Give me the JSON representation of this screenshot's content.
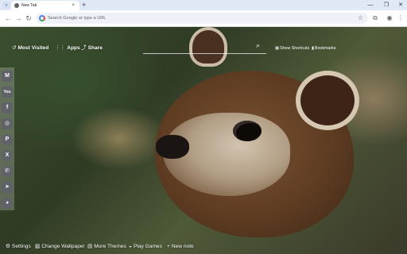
{
  "browser": {
    "tab_title": "New Tab",
    "tab_close": "×",
    "new_tab": "+",
    "tab_menu": "⌄",
    "window": {
      "minimize": "—",
      "maximize": "❐",
      "close": "✕"
    },
    "omnibox_placeholder": "Search Google or type a URL",
    "icons": {
      "back": "←",
      "forward": "→",
      "reload": "↻",
      "star": "☆",
      "extensions": "⧉",
      "profile": "◉",
      "menu": "⋮"
    }
  },
  "ntp": {
    "top_links": [
      {
        "icon": "↺",
        "label": "Most Visited"
      },
      {
        "icon": "⋮⋮",
        "label": "Apps"
      },
      {
        "icon": "⤴",
        "label": "Share"
      }
    ],
    "search_icon": "⌕",
    "mini_links": [
      {
        "icon": "▦",
        "label": "Show Shortcuts"
      },
      {
        "icon": "▮",
        "label": "Bookmarks"
      }
    ],
    "social": [
      {
        "name": "gmail",
        "glyph": "M",
        "color": "#5f6368"
      },
      {
        "name": "youtube",
        "glyph": "You",
        "color": "#5f6368"
      },
      {
        "name": "facebook",
        "glyph": "f",
        "color": "#5f6368"
      },
      {
        "name": "instagram",
        "glyph": "◎",
        "color": "#5f6368"
      },
      {
        "name": "pinterest",
        "glyph": "P",
        "color": "#5f6368"
      },
      {
        "name": "x",
        "glyph": "X",
        "color": "#5f6368"
      },
      {
        "name": "whatsapp",
        "glyph": "✆",
        "color": "#5f6368"
      },
      {
        "name": "telegram",
        "glyph": "➤",
        "color": "#5f6368"
      },
      {
        "name": "reddit",
        "glyph": "◕",
        "color": "#5f6368"
      }
    ],
    "bottom_links": [
      {
        "icon": "⚙",
        "label": "Settings"
      },
      {
        "icon": "▨",
        "label": "Change Wallpaper"
      },
      {
        "icon": "▤",
        "label": "More Themes"
      },
      {
        "icon": "◒",
        "label": "Play Games"
      },
      {
        "icon": "+",
        "label": "New note"
      }
    ]
  }
}
